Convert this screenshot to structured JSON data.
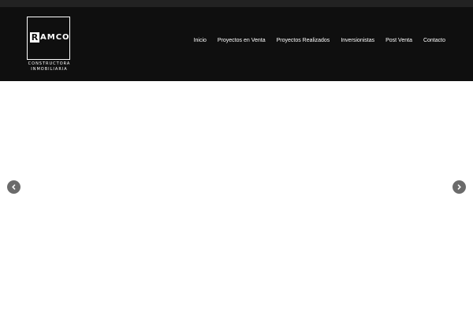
{
  "logo": {
    "initial": "R",
    "rest": "AMCO",
    "subtitle_line1": "CONSTRUCTORA",
    "subtitle_line2": "INMOBILIARIA"
  },
  "nav": {
    "items": [
      {
        "label": "Inicio"
      },
      {
        "label": "Proyectos en Venta"
      },
      {
        "label": "Proyectos Realizados"
      },
      {
        "label": "Inversionistas"
      },
      {
        "label": "Post Venta"
      },
      {
        "label": "Contacto"
      }
    ]
  },
  "slider": {
    "prev_icon": "chevron-left-icon",
    "next_icon": "chevron-right-icon"
  },
  "colors": {
    "topbar": "#222222",
    "header": "#0f0f0f",
    "nav_text": "#ffffff",
    "arrow_bg": "#6b6b6b"
  }
}
